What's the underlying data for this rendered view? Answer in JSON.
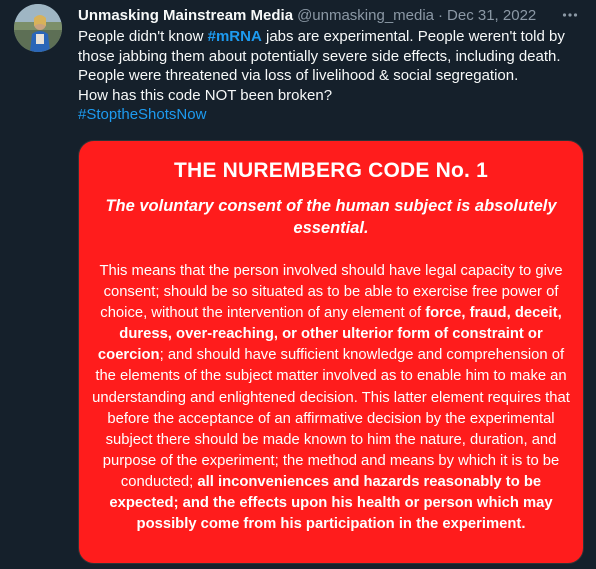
{
  "author": {
    "display_name": "Unmasking Mainstream Media",
    "handle": "@unmasking_media",
    "separator": "·",
    "date": "Dec 31, 2022"
  },
  "tweet": {
    "line1_before": "People didn't know ",
    "hashtag_mrna": "#mRNA",
    "line1_after": " jabs are experimental. People weren't told by those jabbing them about potentially severe side effects, including death. People were threatened via loss of livelihood & social segregation.",
    "line2": "How has this code NOT been broken?",
    "hashtag_stop": "#StoptheShotsNow"
  },
  "media": {
    "title": "THE NUREMBERG CODE No. 1",
    "subtitle": "The voluntary consent of the human subject is absolutely essential.",
    "body_1": "This means that the person involved should have legal capacity to give consent; should be so situated as to be able to exercise free power of choice, without the intervention of any element of ",
    "body_bold_1": "force, fraud, deceit, duress, over-reaching, or other ulterior form of constraint or coercion",
    "body_2": "; and should have sufficient knowledge and comprehension of the elements of the subject matter involved as to enable him to make an understanding and enlightened decision. This latter element requires that before the acceptance of an affirmative decision by the experimental subject there should be made known to him the nature, duration, and purpose of the experiment; the method and means by which it is to be conducted; ",
    "body_bold_2": "all inconveniences and hazards reasonably to be expected",
    "body_3": "; ",
    "body_bold_3": "and the effects upon his health or person which may possibly come from his participation in the experiment."
  },
  "colors": {
    "background": "#15202b",
    "text": "#f7f9f9",
    "secondary": "#8b98a5",
    "link": "#1d9bf0",
    "media_bg": "#ff1c1c"
  },
  "icons": {
    "more": "more-horizontal-icon"
  }
}
